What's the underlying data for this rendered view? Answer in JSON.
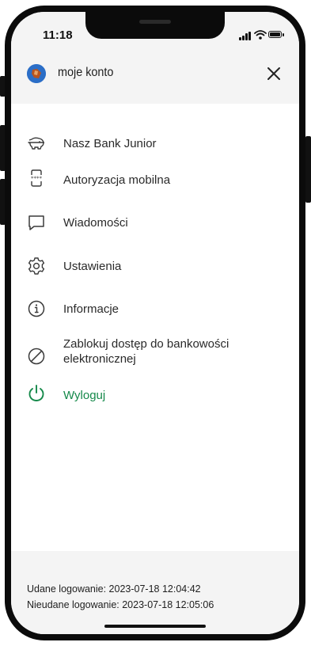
{
  "status_bar": {
    "time": "11:18"
  },
  "header": {
    "title": "moje konto",
    "close_icon": "close-icon"
  },
  "menu": {
    "items": [
      {
        "label": "Nasz Bank Junior",
        "icon": "piggy-bank-icon"
      },
      {
        "label": "Autoryzacja mobilna",
        "icon": "mobile-authorization-icon"
      },
      {
        "label": "Wiadomości",
        "icon": "message-icon"
      },
      {
        "label": "Ustawienia",
        "icon": "gear-icon"
      },
      {
        "label": "Informacje",
        "icon": "info-icon"
      },
      {
        "label": "Zablokuj dostęp do bankowości elektronicznej",
        "icon": "block-icon"
      },
      {
        "label": "Wyloguj",
        "icon": "power-icon"
      }
    ]
  },
  "footer": {
    "success_login": "Udane logowanie: 2023-07-18 12:04:42",
    "failed_login": "Nieudane logowanie: 2023-07-18 12:05:06"
  },
  "colors": {
    "accent": "#15894a",
    "header_bg": "#f4f4f4",
    "icon": "#3a3a3a"
  }
}
